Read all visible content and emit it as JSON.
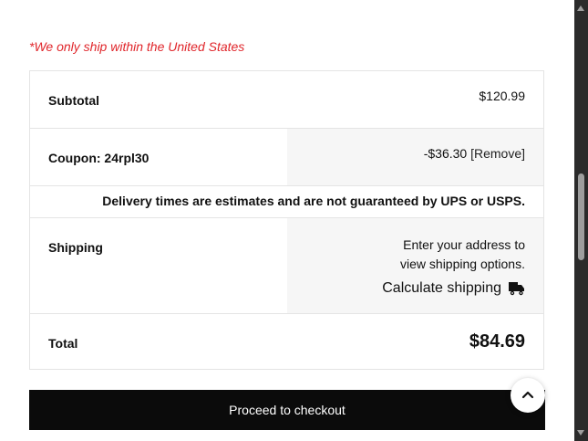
{
  "notice": "*We only ship within the United States",
  "totals": {
    "subtotal_label": "Subtotal",
    "subtotal_value": "$120.99",
    "coupon_label": "Coupon: 24rpl30",
    "coupon_value": "-$36.30",
    "coupon_remove": "[Remove]",
    "delivery_note": "Delivery times are estimates and are not guaranteed by UPS or USPS.",
    "shipping_label": "Shipping",
    "shipping_line1": "Enter your address to",
    "shipping_line2": "view shipping options.",
    "calculate_shipping": "Calculate shipping",
    "total_label": "Total",
    "total_value": "$84.69"
  },
  "checkout_button": "Proceed to checkout",
  "icons": {
    "calculate_shipping_icon": "truck-icon",
    "back_to_top_icon": "chevron-up-icon"
  },
  "colors": {
    "notice": "#e0262b",
    "button_bg": "#0b0b0b",
    "shaded_cell": "#f6f6f6"
  }
}
